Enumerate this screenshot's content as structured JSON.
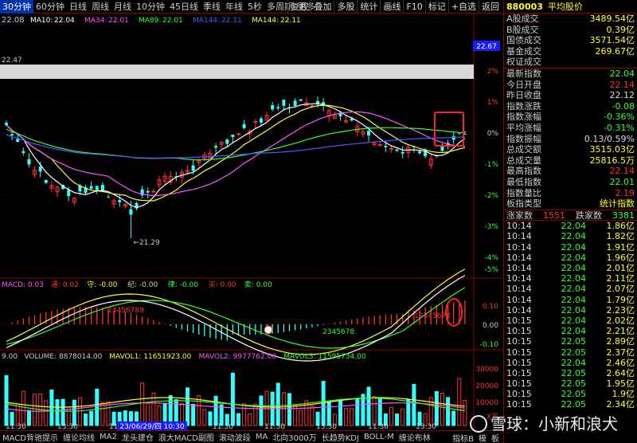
{
  "toolbar": {
    "left_items": [
      "30分钟",
      "60分钟",
      "日线",
      "周线",
      "月线",
      "10分钟",
      "45日线",
      "季线",
      "年线",
      "5秒",
      "多周期",
      "更多"
    ],
    "right_items": [
      "复权",
      "叠加",
      "多股",
      "统计",
      "画线",
      "F10",
      "标记",
      "+自选",
      "返回"
    ]
  },
  "ma_legend": {
    "price_label": "22.08",
    "items": [
      {
        "name": "MA10:",
        "value": "22.04",
        "color": "#ffffff"
      },
      {
        "name": "MA34:",
        "value": "22.01",
        "color": "#ff55ff"
      },
      {
        "name": "MA89:",
        "value": "22.01",
        "color": "#33ff33"
      },
      {
        "name": "MA144:",
        "value": "22.11",
        "color": "#5555ff"
      },
      {
        "name": "MA144:",
        "value": "22.11",
        "color": "#ffff33"
      }
    ]
  },
  "main_chart": {
    "price_high_label": "22.67",
    "left_label": "22.47",
    "low_annotation": "21.29",
    "pct_ticks": [
      "2%",
      "1%",
      "0%",
      "-1%",
      "-2%",
      "-3%",
      "-4%",
      "-5%"
    ]
  },
  "macd": {
    "legend": [
      {
        "text": "MACD: 0.03",
        "color": "#ff55ff"
      },
      {
        "text": "通: 0.02",
        "color": "#ff3333"
      },
      {
        "text": "守: -0.00",
        "color": "#ffff33"
      },
      {
        "text": "纪: -0.00",
        "color": "#ccc"
      },
      {
        "text": "律: -0.00",
        "color": "#33ff33"
      },
      {
        "text": "买: 0.00",
        "color": "#ff3333"
      },
      {
        "text": "卖: 0.00",
        "color": "#33ff33"
      }
    ],
    "y_ticks": [
      "0.10",
      "0.00",
      "-0.10"
    ],
    "annotations": [
      "23456789",
      "12345678",
      "2345678"
    ]
  },
  "volume": {
    "legend": [
      {
        "text": "9.00",
        "color": "#ccc"
      },
      {
        "text": "VOLUME: 8878014.00",
        "color": "#ccc"
      },
      {
        "text": "MAVOL1: 11651923.00",
        "color": "#ffff33"
      },
      {
        "text": "MAVOL2: 9977762.00",
        "color": "#ff55ff"
      },
      {
        "text": "MAVOL3: 11595734.00",
        "color": "#33ff33"
      }
    ],
    "y_ticks": [
      "30000",
      "20000",
      "10000",
      "X万"
    ],
    "x_labels": [
      "11:30",
      "13:30",
      "11:30",
      "13:30",
      "11:30",
      "11:30",
      "13:30",
      "11:30",
      "13:30"
    ],
    "cursor_label": "23/06/29/四 10:30"
  },
  "right_panel": {
    "code": "880003",
    "name": "平均股价",
    "summary": [
      {
        "label": "A股成交",
        "value": "3489.54亿",
        "color": "yellow"
      },
      {
        "label": "B股成交",
        "value": "0.39亿",
        "color": "yellow"
      },
      {
        "label": "国债成交",
        "value": "3571.54亿",
        "color": "yellow"
      },
      {
        "label": "基金成交",
        "value": "269.67亿",
        "color": "yellow"
      },
      {
        "label": "权证成交",
        "value": "",
        "color": "yellow"
      }
    ],
    "stats": [
      {
        "label": "最新指数",
        "value": "22.04",
        "color": "green"
      },
      {
        "label": "今日开盘",
        "value": "22.14",
        "color": "red"
      },
      {
        "label": "昨日收盘",
        "value": "22.12",
        "color": "white"
      },
      {
        "label": "指数涨跌",
        "value": "-0.08",
        "color": "green"
      },
      {
        "label": "指数涨幅",
        "value": "-0.36%",
        "color": "green"
      },
      {
        "label": "平均涨幅",
        "value": "-0.31%",
        "color": "green"
      },
      {
        "label": "指数振幅",
        "value": "0.13/0.59%",
        "color": "white"
      },
      {
        "label": "总成交额",
        "value": "3515.03亿",
        "color": "yellow"
      },
      {
        "label": "总成交量",
        "value": "25816.5万",
        "color": "yellow"
      },
      {
        "label": "最高指数",
        "value": "22.14",
        "color": "red"
      },
      {
        "label": "最低指数",
        "value": "22.01",
        "color": "green"
      },
      {
        "label": "指数量比",
        "value": "2.19",
        "color": "red"
      },
      {
        "label": "板指类型",
        "value": "统计指数",
        "color": "yellow"
      }
    ],
    "updown": {
      "up_label": "涨家数",
      "up_value": "1551",
      "down_label": "跌家数",
      "down_value": "3381"
    },
    "ticks": [
      {
        "t": "10:14",
        "p": "22.04",
        "v": "1.86亿"
      },
      {
        "t": "10:14",
        "p": "22.04",
        "v": "1.82亿"
      },
      {
        "t": "10:14",
        "p": "22.04",
        "v": "1.91亿"
      },
      {
        "t": "10:14",
        "p": "22.04",
        "v": "1.96亿"
      },
      {
        "t": "10:14",
        "p": "22.04",
        "v": "2.01亿"
      },
      {
        "t": "10:14",
        "p": "22.04",
        "v": "2.11亿"
      },
      {
        "t": "10:14",
        "p": "22.04",
        "v": "2.07亿"
      },
      {
        "t": "10:14",
        "p": "22.04",
        "v": "1.79亿"
      },
      {
        "t": "10:14",
        "p": "22.04",
        "v": "2.23亿"
      },
      {
        "t": "10:15",
        "p": "22.04",
        "v": "2.02亿"
      },
      {
        "t": "10:15",
        "p": "22.04",
        "v": "2.21亿"
      },
      {
        "t": "10:15",
        "p": "22.05",
        "v": "2.89亿"
      },
      {
        "t": "10:15",
        "p": "22.05",
        "v": "2.37亿"
      },
      {
        "t": "10:15",
        "p": "22.04",
        "v": "2.46亿"
      },
      {
        "t": "10:15",
        "p": "22.05",
        "v": "2.64亿"
      },
      {
        "t": "10:15",
        "p": "22.05",
        "v": "1.95亿"
      },
      {
        "t": "10:15",
        "p": "22.05",
        "v": "1.9亿"
      },
      {
        "t": "10:15",
        "p": "22.05",
        "v": "2.34亿"
      }
    ]
  },
  "bottom_bar": {
    "items": [
      "MACD背驰提示",
      "缠论均线",
      "MA2",
      "龙头建仓",
      "浪大MACD副图",
      "滚动波段",
      "MA",
      "北向3000万",
      "长趋势KDJ",
      "BOLL-M",
      "缠论布林"
    ],
    "right_items": [
      "指标B",
      "模",
      "板"
    ]
  },
  "watermark": {
    "text": "雪球：小新和浪犬"
  }
}
